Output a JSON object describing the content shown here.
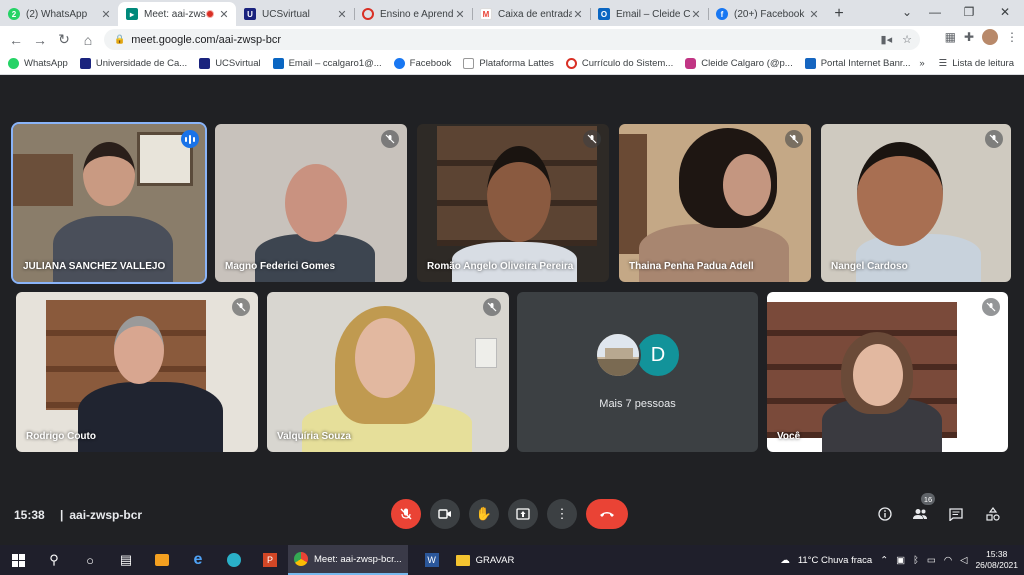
{
  "browser": {
    "tabs": [
      {
        "title": "(2) WhatsApp",
        "icon": "whatsapp-icon",
        "color": "#25d366"
      },
      {
        "title": "Meet: aai-zws",
        "icon": "meet-icon",
        "color": "#00897b",
        "active": true
      },
      {
        "title": "UCSvirtual",
        "icon": "ucs-icon",
        "color": "#1a237e"
      },
      {
        "title": "Ensino e Aprendiz",
        "icon": "ring-icon",
        "color": "#d93025"
      },
      {
        "title": "Caixa de entrada",
        "icon": "gmail-icon",
        "color": "#ea4335"
      },
      {
        "title": "Email – Cleide Cal",
        "icon": "outlook-icon",
        "color": "#0a66c2"
      },
      {
        "title": "(20+) Facebook",
        "icon": "facebook-icon",
        "color": "#1877f2"
      }
    ],
    "url": "meet.google.com/aai-zwsp-bcr",
    "bookmarks": [
      {
        "label": "WhatsApp",
        "color": "#25d366"
      },
      {
        "label": "Universidade de Ca...",
        "color": "#1a237e"
      },
      {
        "label": "UCSvirtual",
        "color": "#1a237e"
      },
      {
        "label": "Email – ccalgaro1@...",
        "color": "#0a66c2"
      },
      {
        "label": "Facebook",
        "color": "#1877f2"
      },
      {
        "label": "Plataforma Lattes",
        "color": "#3c4043"
      },
      {
        "label": "Currículo do Sistem...",
        "color": "#d93025"
      },
      {
        "label": "Cleide Calgaro (@p...",
        "color": "#c13584"
      },
      {
        "label": "Portal Internet Banr...",
        "color": "#1565c0"
      }
    ],
    "bookmarks_more": "»",
    "reading_list": "Lista de leitura"
  },
  "meet": {
    "participants": [
      {
        "name": "JULIANA SANCHEZ VALLEJO",
        "speaking": true
      },
      {
        "name": "Magno Federici Gomes"
      },
      {
        "name": "Romão Angelo Oliveira Pereira"
      },
      {
        "name": "Thaina Penha Padua Adell"
      },
      {
        "name": "Nangel Cardoso"
      },
      {
        "name": "Rodrigo Couto"
      },
      {
        "name": "Valquíria Souza"
      },
      {
        "name": "Você"
      }
    ],
    "more": {
      "initial": "D",
      "label": "Mais 7 pessoas"
    },
    "time": "15:38",
    "meeting_code": "aai-zwsp-bcr",
    "people_count": "16"
  },
  "taskbar": {
    "chrome_task": "Meet: aai-zwsp-bcr...",
    "folder_task": "GRAVAR",
    "weather": "11°C  Chuva fraca",
    "clock_time": "15:38",
    "clock_date": "26/08/2021"
  }
}
